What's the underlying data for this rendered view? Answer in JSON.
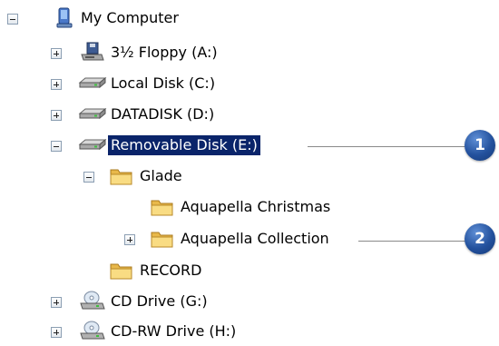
{
  "tree": {
    "root_label": "My Computer",
    "floppy_label": "3½ Floppy (A:)",
    "local_disk_label": "Local Disk (C:)",
    "datadisk_label": "DATADISK (D:)",
    "removable_label": "Removable Disk (E:)",
    "glade_label": "Glade",
    "christmas_label": "Aquapella Christmas",
    "collection_label": "Aquapella Collection",
    "record_label": "RECORD",
    "cd_label": "CD Drive (G:)",
    "cdrw_label": "CD-RW Drive (H:)"
  },
  "callouts": {
    "first": "1",
    "second": "2"
  },
  "colors": {
    "selection": "#0a246a",
    "badge": "#23519d"
  }
}
